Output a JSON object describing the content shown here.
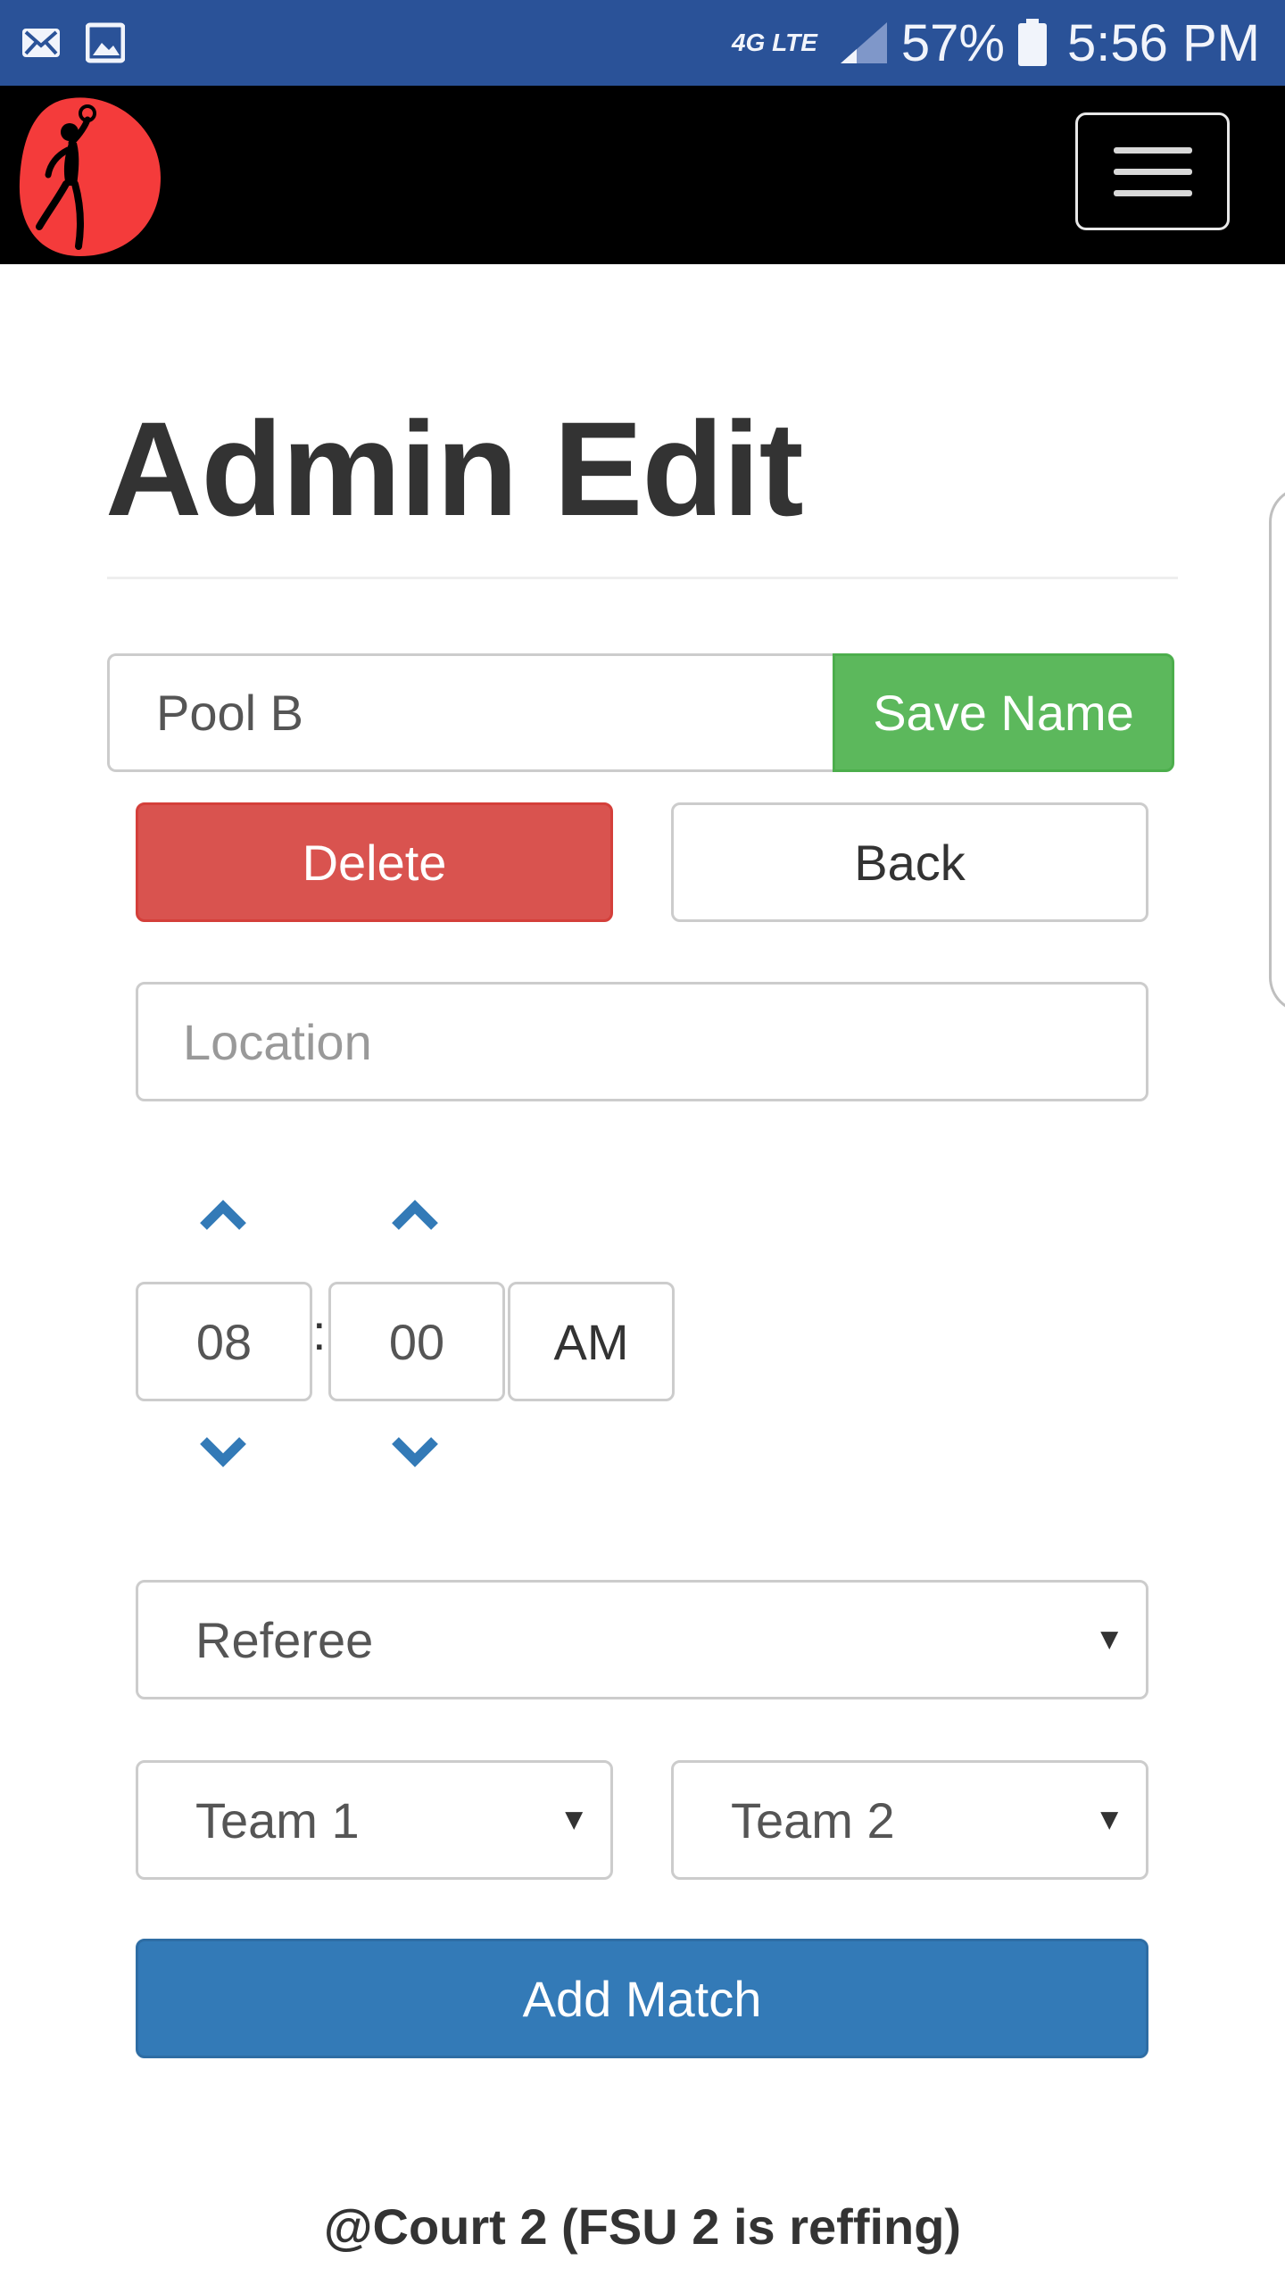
{
  "status_bar": {
    "battery": "57%",
    "time": "5:56 PM",
    "network": "4G LTE",
    "icons": [
      "mail-icon",
      "image-icon",
      "signal-icon",
      "battery-icon"
    ]
  },
  "navbar": {
    "logo": "volleyball-player-logo",
    "menu_icon": "hamburger-menu-icon"
  },
  "page": {
    "title": "Admin Edit"
  },
  "pool": {
    "name_value": "Pool B",
    "save_label": "Save Name",
    "delete_label": "Delete",
    "back_label": "Back"
  },
  "match_form": {
    "location_placeholder": "Location",
    "time": {
      "hour": "08",
      "separator": ":",
      "minute": "00",
      "meridian": "AM"
    },
    "referee_label": "Referee",
    "team1_label": "Team 1",
    "team2_label": "Team 2",
    "add_label": "Add Match"
  },
  "court_text": "@Court 2 (FSU 2 is reffing)",
  "colors": {
    "status_bar": "#2a5298",
    "navbar": "#000000",
    "success": "#5cb85c",
    "danger": "#d9534f",
    "primary": "#337ab7",
    "chevron": "#337ab7",
    "logo_red": "#f43b3b"
  }
}
